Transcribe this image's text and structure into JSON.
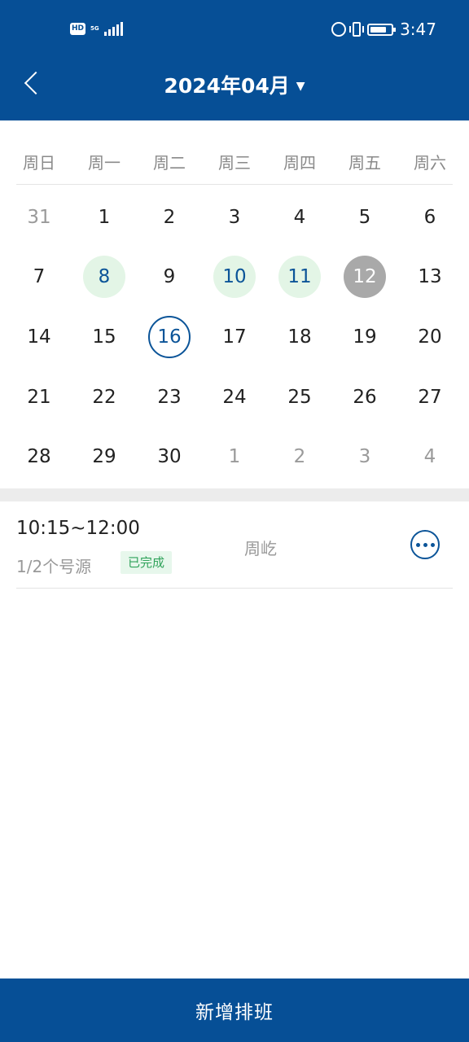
{
  "status_bar": {
    "hd_badge": "HD",
    "network": "5G",
    "time": "3:47",
    "icons": [
      "alarm-icon",
      "vibrate-icon",
      "battery-icon"
    ],
    "battery_level": 0.85
  },
  "header": {
    "title": "2024年04月",
    "caret": "▼"
  },
  "calendar": {
    "weekdays": [
      "周日",
      "周一",
      "周二",
      "周三",
      "周四",
      "周五",
      "周六"
    ],
    "weeks": [
      [
        {
          "d": "31",
          "s": "other"
        },
        {
          "d": "1",
          "s": ""
        },
        {
          "d": "2",
          "s": ""
        },
        {
          "d": "3",
          "s": ""
        },
        {
          "d": "4",
          "s": ""
        },
        {
          "d": "5",
          "s": ""
        },
        {
          "d": "6",
          "s": ""
        }
      ],
      [
        {
          "d": "7",
          "s": ""
        },
        {
          "d": "8",
          "s": "sched"
        },
        {
          "d": "9",
          "s": ""
        },
        {
          "d": "10",
          "s": "sched"
        },
        {
          "d": "11",
          "s": "sched"
        },
        {
          "d": "12",
          "s": "done"
        },
        {
          "d": "13",
          "s": ""
        }
      ],
      [
        {
          "d": "14",
          "s": ""
        },
        {
          "d": "15",
          "s": ""
        },
        {
          "d": "16",
          "s": "today"
        },
        {
          "d": "17",
          "s": ""
        },
        {
          "d": "18",
          "s": ""
        },
        {
          "d": "19",
          "s": ""
        },
        {
          "d": "20",
          "s": ""
        }
      ],
      [
        {
          "d": "21",
          "s": ""
        },
        {
          "d": "22",
          "s": ""
        },
        {
          "d": "23",
          "s": ""
        },
        {
          "d": "24",
          "s": ""
        },
        {
          "d": "25",
          "s": ""
        },
        {
          "d": "26",
          "s": ""
        },
        {
          "d": "27",
          "s": ""
        }
      ],
      [
        {
          "d": "28",
          "s": ""
        },
        {
          "d": "29",
          "s": ""
        },
        {
          "d": "30",
          "s": ""
        },
        {
          "d": "1",
          "s": "other"
        },
        {
          "d": "2",
          "s": "other"
        },
        {
          "d": "3",
          "s": "other"
        },
        {
          "d": "4",
          "s": "other"
        }
      ]
    ]
  },
  "schedule": {
    "time": "10:15~12:00",
    "count": "1/2个号源",
    "status": "已完成",
    "doctor": "周屹"
  },
  "footer": {
    "add_label": "新增排班"
  },
  "colors": {
    "primary": "#064f96",
    "scheduled_bg": "#e3f5e6",
    "done_bg": "#a9a9a9",
    "status_green": "#2fa25a"
  }
}
